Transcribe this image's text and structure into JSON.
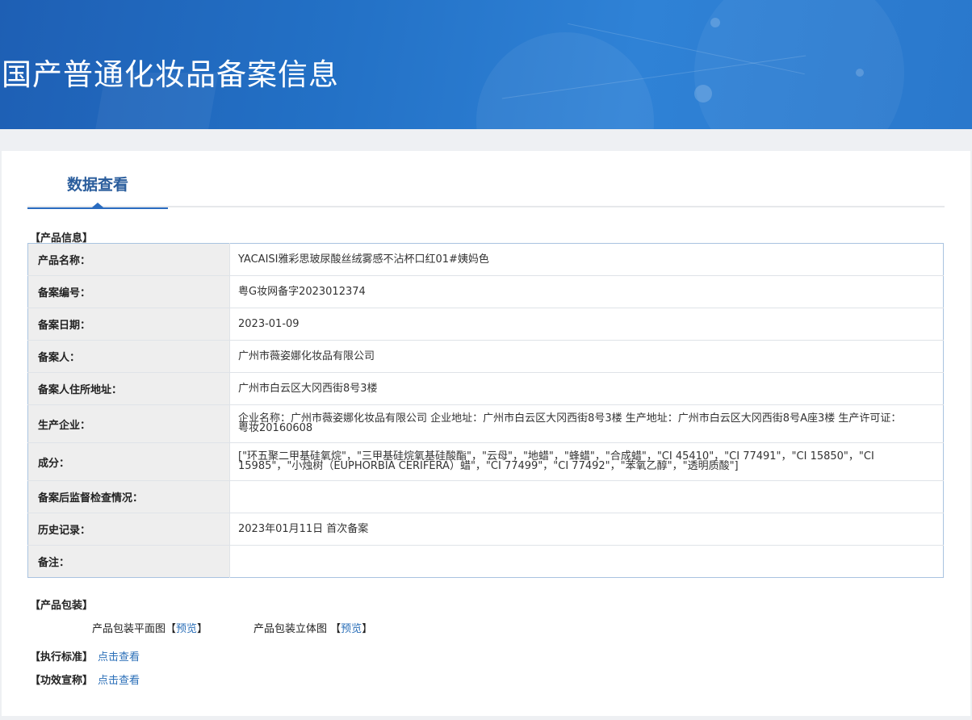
{
  "banner": {
    "title": "国产普通化妆品备案信息"
  },
  "tab": {
    "label": "数据查看"
  },
  "product_info": {
    "section_title": "【产品信息】",
    "rows": [
      {
        "key": "产品名称：",
        "value": "YACAISI雅彩思玻尿酸丝绒雾感不沾杯口红01#姨妈色"
      },
      {
        "key": "备案编号：",
        "value": "粤G妆网备字2023012374"
      },
      {
        "key": "备案日期：",
        "value": "2023-01-09"
      },
      {
        "key": "备案人：",
        "value": "广州市薇姿娜化妆品有限公司"
      },
      {
        "key": "备案人住所地址：",
        "value": "广州市白云区大冈西街8号3楼"
      },
      {
        "key": "生产企业：",
        "value": "企业名称：广州市薇姿娜化妆品有限公司 企业地址：广州市白云区大冈西街8号3楼 生产地址：广州市白云区大冈西街8号A座3楼 生产许可证：粤妆20160608"
      },
      {
        "key": "成分：",
        "value": "[\"环五聚二甲基硅氧烷\"，\"三甲基硅烷氧基硅酸酯\"，\"云母\"，\"地蜡\"，\"蜂蜡\"，\"合成蜡\"，\"CI 45410\"，\"CI 77491\"，\"CI 15850\"，\"CI 15985\"，\"小烛树（EUPHORBIA CERIFERA）蜡\"，\"CI 77499\"，\"CI 77492\"，\"苯氧乙醇\"，\"透明质酸\"]"
      },
      {
        "key": "备案后监督检查情况：",
        "value": ""
      },
      {
        "key": "历史记录：",
        "value": "2023年01月11日 首次备案"
      },
      {
        "key": "备注：",
        "value": ""
      }
    ]
  },
  "packaging": {
    "section_title": "【产品包装】",
    "flat_label": "产品包装平面图",
    "solid_label": "产品包装立体图",
    "bracket_open": "【",
    "bracket_close": "】",
    "preview_label": "预览"
  },
  "standard": {
    "label": "【执行标准】",
    "link": "点击查看"
  },
  "efficacy": {
    "label": "【功效宣称】",
    "link": "点击查看"
  }
}
